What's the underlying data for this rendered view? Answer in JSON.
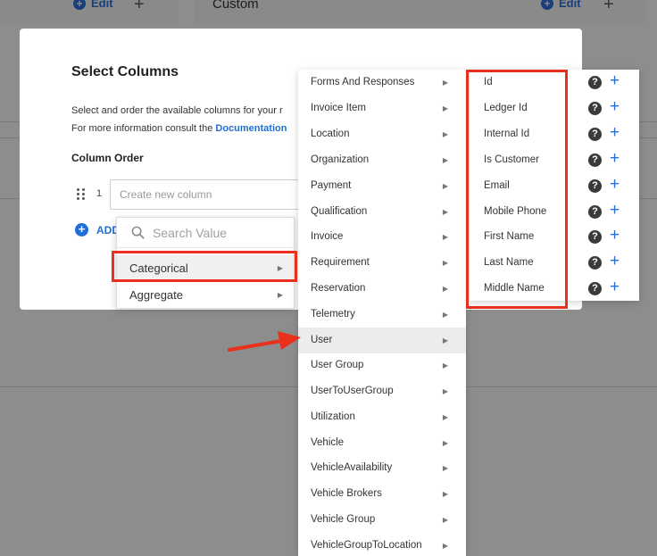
{
  "background": {
    "edit_label": "Edit",
    "custom_label": "Custom"
  },
  "modal": {
    "title": "Select Columns",
    "description": "Select and order the available columns for your r",
    "docs_prefix": "For more information consult the ",
    "docs_link": "Documentation",
    "column_order_label": "Column Order",
    "row_number": "1",
    "new_column_placeholder": "Create new column",
    "add_label": "ADD"
  },
  "dropdown1": {
    "search_placeholder": "Search Value",
    "items": [
      {
        "label": "Categorical",
        "has_submenu": true,
        "highlighted": true
      },
      {
        "label": "Aggregate",
        "has_submenu": true
      }
    ]
  },
  "dropdown2": {
    "items": [
      {
        "label": "Forms And Responses"
      },
      {
        "label": "Invoice Item"
      },
      {
        "label": "Location"
      },
      {
        "label": "Organization"
      },
      {
        "label": "Payment"
      },
      {
        "label": "Qualification"
      },
      {
        "label": "Invoice"
      },
      {
        "label": "Requirement"
      },
      {
        "label": "Reservation"
      },
      {
        "label": "Telemetry"
      },
      {
        "label": "User",
        "active": true
      },
      {
        "label": "User Group"
      },
      {
        "label": "UserToUserGroup"
      },
      {
        "label": "Utilization"
      },
      {
        "label": "Vehicle"
      },
      {
        "label": "VehicleAvailability"
      },
      {
        "label": "Vehicle Brokers"
      },
      {
        "label": "Vehicle Group"
      },
      {
        "label": "VehicleGroupToLocation"
      }
    ]
  },
  "dropdown3": {
    "items": [
      {
        "label": "Id"
      },
      {
        "label": "Ledger Id"
      },
      {
        "label": "Internal Id"
      },
      {
        "label": "Is Customer"
      },
      {
        "label": "Email"
      },
      {
        "label": "Mobile Phone"
      },
      {
        "label": "First Name"
      },
      {
        "label": "Last Name"
      },
      {
        "label": "Middle Name"
      }
    ]
  },
  "icons": {
    "help": "question-circle-icon",
    "add": "plus-icon",
    "caret": "chevron-right-icon",
    "search": "search-icon"
  },
  "colors": {
    "accent": "#1f6fd6",
    "highlight": "#e8301b",
    "active_row": "#ececec"
  }
}
